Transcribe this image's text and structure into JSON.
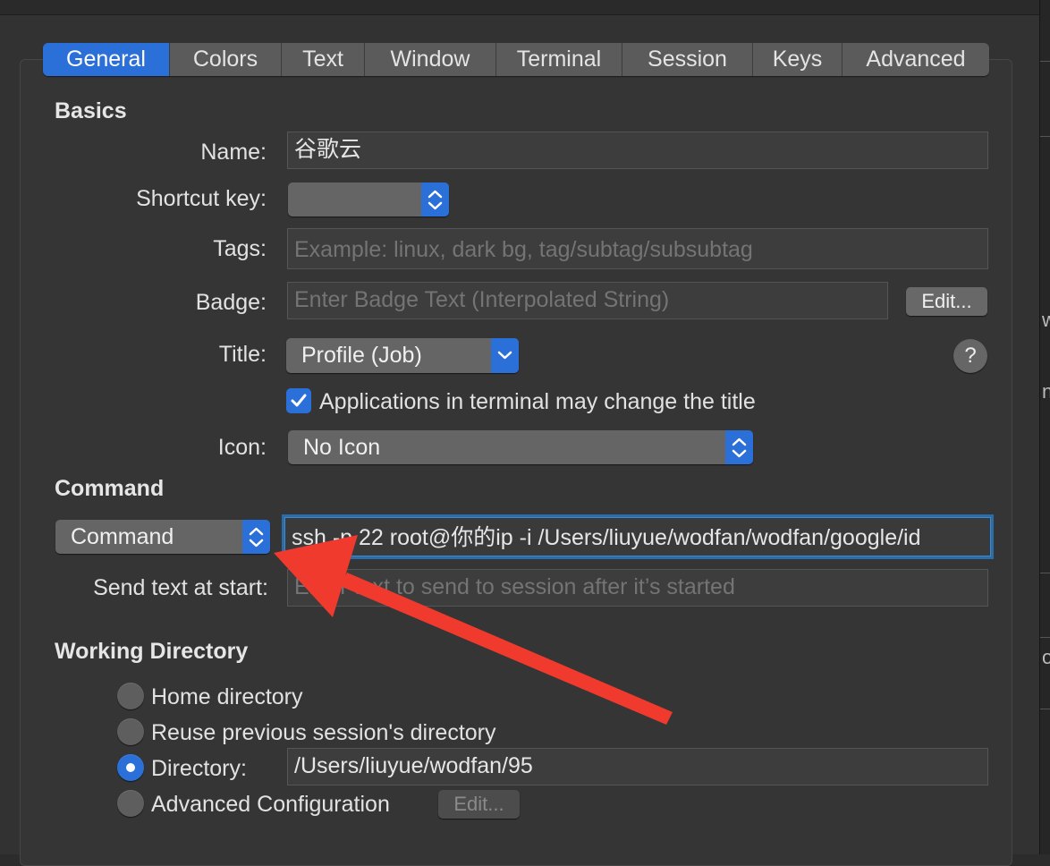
{
  "tabs": [
    "General",
    "Colors",
    "Text",
    "Window",
    "Terminal",
    "Session",
    "Keys",
    "Advanced"
  ],
  "active_tab": "General",
  "basics": {
    "title": "Basics",
    "name_label": "Name:",
    "name_value": "谷歌云",
    "shortcut_label": "Shortcut key:",
    "tags_label": "Tags:",
    "tags_placeholder": "Example: linux, dark bg, tag/subtag/subsubtag",
    "badge_label": "Badge:",
    "badge_placeholder": "Enter Badge Text (Interpolated String)",
    "badge_edit": "Edit...",
    "title_label": "Title:",
    "title_value": "Profile (Job)",
    "help_glyph": "?",
    "apps_change_title": "Applications in terminal may change the title",
    "icon_label": "Icon:",
    "icon_value": "No Icon"
  },
  "command": {
    "title": "Command",
    "mode_value": "Command",
    "command_value": "ssh -p 22 root@你的ip -i /Users/liuyue/wodfan/wodfan/google/id",
    "send_text_label": "Send text at start:",
    "send_text_placeholder": "Enter text to send to session after it’s started"
  },
  "working_directory": {
    "title": "Working Directory",
    "home": "Home directory",
    "reuse": "Reuse previous session's directory",
    "directory": "Directory:",
    "directory_value": "/Users/liuyue/wodfan/95",
    "advanced": "Advanced Configuration",
    "advanced_edit": "Edit..."
  },
  "colors": {
    "accent": "#2b6fd8",
    "annotation_arrow": "#f03a2e"
  },
  "icons": {
    "checkbox": "checkmark-icon",
    "popup": "up-down-chevron-icon",
    "arrow": "red-arrow-annotation"
  }
}
